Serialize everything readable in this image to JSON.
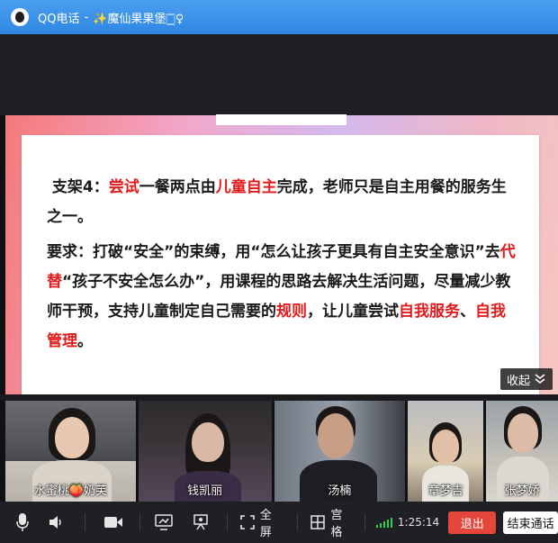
{
  "window": {
    "app_title": "QQ电话",
    "separator": "-",
    "contact_name": "✨魔仙果果堡🀆♀"
  },
  "slide": {
    "header_strip_left": "",
    "header_strip_right": "",
    "paragraph1": {
      "p1": "支架4：",
      "r1": "尝试",
      "p2": "一餐两点由",
      "r2": "儿童自主",
      "p3": "完成，老师只是自主用餐的服务生之一。"
    },
    "paragraph2": {
      "p1": "要求：打破“安全”的束缚，用“怎么让孩子更具有自主安全意识”去",
      "r1": "代替",
      "p2": "“孩子不安全怎么办”，用课程的思路去解决生活问题，尽量减少教师干预，支持儿童制定自己需要的",
      "r2": "规则",
      "p3": "，让儿童尝试",
      "r3": "自我服务",
      "p4": "、",
      "r4": "自我管理",
      "p5": "。"
    }
  },
  "collapse_button": {
    "label": "收起",
    "icon": "double-chevron-down-icon"
  },
  "participants": [
    {
      "name": "水蜜桃🍑奶芙"
    },
    {
      "name": "钱凯丽"
    },
    {
      "name": "汤楠"
    },
    {
      "name": "章梦吉"
    },
    {
      "name": "张梦娇"
    }
  ],
  "toolbar": {
    "mic_icon": "microphone-icon",
    "speaker_icon": "speaker-icon",
    "camera_icon": "camera-icon",
    "share_screen_icon": "screen-share-icon",
    "whiteboard_icon": "present-icon",
    "fullscreen_label": "全屏",
    "grid_label": "宫格",
    "timer": "1:25:14",
    "exit_label": "退出",
    "end_call_label": "结束通话"
  },
  "colors": {
    "titlebar": "#2f86e3",
    "highlight_red": "#e11b1b",
    "exit_button": "#e4463c",
    "signal_green": "#3ccf4e"
  }
}
